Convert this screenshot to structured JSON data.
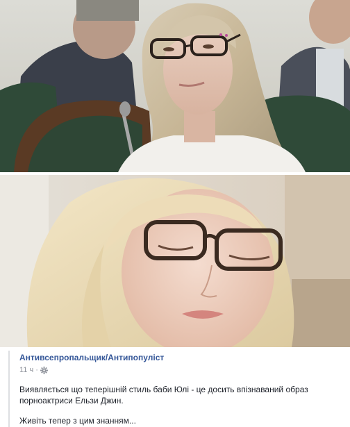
{
  "post": {
    "author": "Антивсепропальщик/Антипопуліст",
    "time": "11 ч",
    "separator": "·",
    "privacy_icon": "gear-icon",
    "text_1": "Виявляється що теперішній стиль баби Юлі - це досить впізнаваний образ порноактриси Ельзи Джин.",
    "text_2": "Живіть тепер з цим знанням..."
  },
  "colors": {
    "author_link": "#365899",
    "meta_gray": "#90949c",
    "text": "#1d2129",
    "divider": "#dddfe2"
  }
}
